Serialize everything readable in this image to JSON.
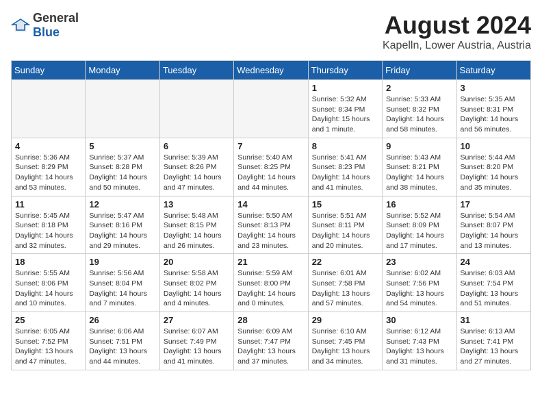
{
  "header": {
    "logo_general": "General",
    "logo_blue": "Blue",
    "title": "August 2024",
    "subtitle": "Kapelln, Lower Austria, Austria"
  },
  "calendar": {
    "weekdays": [
      "Sunday",
      "Monday",
      "Tuesday",
      "Wednesday",
      "Thursday",
      "Friday",
      "Saturday"
    ],
    "weeks": [
      [
        {
          "day": "",
          "info": ""
        },
        {
          "day": "",
          "info": ""
        },
        {
          "day": "",
          "info": ""
        },
        {
          "day": "",
          "info": ""
        },
        {
          "day": "1",
          "info": "Sunrise: 5:32 AM\nSunset: 8:34 PM\nDaylight: 15 hours\nand 1 minute."
        },
        {
          "day": "2",
          "info": "Sunrise: 5:33 AM\nSunset: 8:32 PM\nDaylight: 14 hours\nand 58 minutes."
        },
        {
          "day": "3",
          "info": "Sunrise: 5:35 AM\nSunset: 8:31 PM\nDaylight: 14 hours\nand 56 minutes."
        }
      ],
      [
        {
          "day": "4",
          "info": "Sunrise: 5:36 AM\nSunset: 8:29 PM\nDaylight: 14 hours\nand 53 minutes."
        },
        {
          "day": "5",
          "info": "Sunrise: 5:37 AM\nSunset: 8:28 PM\nDaylight: 14 hours\nand 50 minutes."
        },
        {
          "day": "6",
          "info": "Sunrise: 5:39 AM\nSunset: 8:26 PM\nDaylight: 14 hours\nand 47 minutes."
        },
        {
          "day": "7",
          "info": "Sunrise: 5:40 AM\nSunset: 8:25 PM\nDaylight: 14 hours\nand 44 minutes."
        },
        {
          "day": "8",
          "info": "Sunrise: 5:41 AM\nSunset: 8:23 PM\nDaylight: 14 hours\nand 41 minutes."
        },
        {
          "day": "9",
          "info": "Sunrise: 5:43 AM\nSunset: 8:21 PM\nDaylight: 14 hours\nand 38 minutes."
        },
        {
          "day": "10",
          "info": "Sunrise: 5:44 AM\nSunset: 8:20 PM\nDaylight: 14 hours\nand 35 minutes."
        }
      ],
      [
        {
          "day": "11",
          "info": "Sunrise: 5:45 AM\nSunset: 8:18 PM\nDaylight: 14 hours\nand 32 minutes."
        },
        {
          "day": "12",
          "info": "Sunrise: 5:47 AM\nSunset: 8:16 PM\nDaylight: 14 hours\nand 29 minutes."
        },
        {
          "day": "13",
          "info": "Sunrise: 5:48 AM\nSunset: 8:15 PM\nDaylight: 14 hours\nand 26 minutes."
        },
        {
          "day": "14",
          "info": "Sunrise: 5:50 AM\nSunset: 8:13 PM\nDaylight: 14 hours\nand 23 minutes."
        },
        {
          "day": "15",
          "info": "Sunrise: 5:51 AM\nSunset: 8:11 PM\nDaylight: 14 hours\nand 20 minutes."
        },
        {
          "day": "16",
          "info": "Sunrise: 5:52 AM\nSunset: 8:09 PM\nDaylight: 14 hours\nand 17 minutes."
        },
        {
          "day": "17",
          "info": "Sunrise: 5:54 AM\nSunset: 8:07 PM\nDaylight: 14 hours\nand 13 minutes."
        }
      ],
      [
        {
          "day": "18",
          "info": "Sunrise: 5:55 AM\nSunset: 8:06 PM\nDaylight: 14 hours\nand 10 minutes."
        },
        {
          "day": "19",
          "info": "Sunrise: 5:56 AM\nSunset: 8:04 PM\nDaylight: 14 hours\nand 7 minutes."
        },
        {
          "day": "20",
          "info": "Sunrise: 5:58 AM\nSunset: 8:02 PM\nDaylight: 14 hours\nand 4 minutes."
        },
        {
          "day": "21",
          "info": "Sunrise: 5:59 AM\nSunset: 8:00 PM\nDaylight: 14 hours\nand 0 minutes."
        },
        {
          "day": "22",
          "info": "Sunrise: 6:01 AM\nSunset: 7:58 PM\nDaylight: 13 hours\nand 57 minutes."
        },
        {
          "day": "23",
          "info": "Sunrise: 6:02 AM\nSunset: 7:56 PM\nDaylight: 13 hours\nand 54 minutes."
        },
        {
          "day": "24",
          "info": "Sunrise: 6:03 AM\nSunset: 7:54 PM\nDaylight: 13 hours\nand 51 minutes."
        }
      ],
      [
        {
          "day": "25",
          "info": "Sunrise: 6:05 AM\nSunset: 7:52 PM\nDaylight: 13 hours\nand 47 minutes."
        },
        {
          "day": "26",
          "info": "Sunrise: 6:06 AM\nSunset: 7:51 PM\nDaylight: 13 hours\nand 44 minutes."
        },
        {
          "day": "27",
          "info": "Sunrise: 6:07 AM\nSunset: 7:49 PM\nDaylight: 13 hours\nand 41 minutes."
        },
        {
          "day": "28",
          "info": "Sunrise: 6:09 AM\nSunset: 7:47 PM\nDaylight: 13 hours\nand 37 minutes."
        },
        {
          "day": "29",
          "info": "Sunrise: 6:10 AM\nSunset: 7:45 PM\nDaylight: 13 hours\nand 34 minutes."
        },
        {
          "day": "30",
          "info": "Sunrise: 6:12 AM\nSunset: 7:43 PM\nDaylight: 13 hours\nand 31 minutes."
        },
        {
          "day": "31",
          "info": "Sunrise: 6:13 AM\nSunset: 7:41 PM\nDaylight: 13 hours\nand 27 minutes."
        }
      ]
    ]
  }
}
